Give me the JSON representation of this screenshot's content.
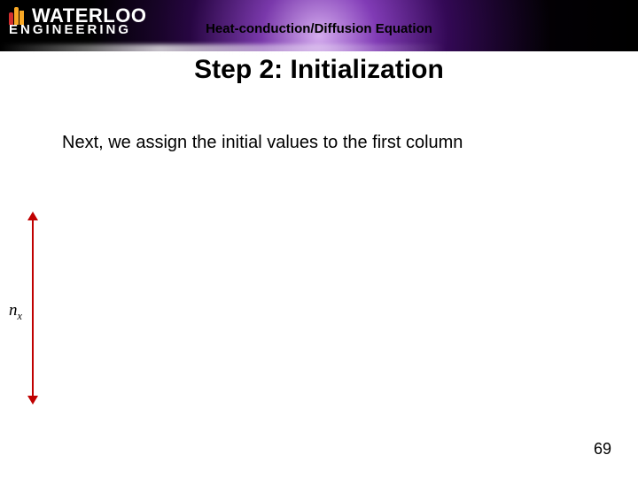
{
  "logo": {
    "line1": "WATERLOO",
    "line2": "ENGINEERING"
  },
  "topic": "Heat-conduction/Diffusion Equation",
  "title": "Step 2:  Initialization",
  "body": "Next, we assign the initial values to the first column",
  "axis_label_var": "n",
  "axis_label_sub": "x",
  "page_number": "69"
}
